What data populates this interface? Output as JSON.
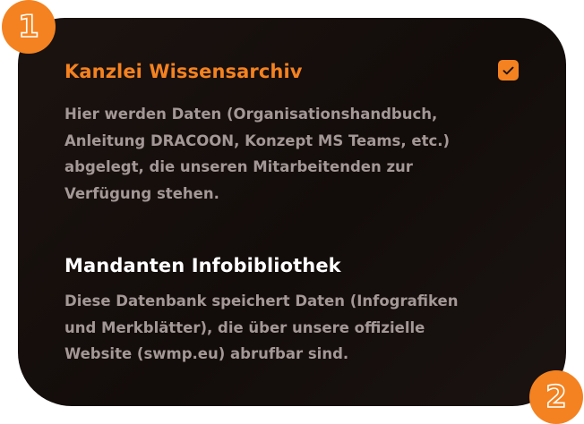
{
  "sections": [
    {
      "title": "Kanzlei Wissensarchiv",
      "description": "Hier werden Daten (Organisationshandbuch, Anleitung DRACOON, Konzept MS Teams, etc.) abgelegt, die unseren Mitarbeitenden zur Verfügung stehen.",
      "checked": true
    },
    {
      "title": "Mandanten Infobibliothek",
      "description": "Diese Datenbank speichert Daten (Infografiken und Merkblätter), die über unsere offizielle Website (swmp.eu) abrufbar sind."
    }
  ],
  "badges": [
    "1",
    "2"
  ],
  "colors": {
    "accent": "#f48220",
    "card_background": "#150e0c",
    "title_secondary": "#ffffff",
    "description_text": "#a39896"
  },
  "icons": {
    "checkbox": "checkmark-icon"
  }
}
